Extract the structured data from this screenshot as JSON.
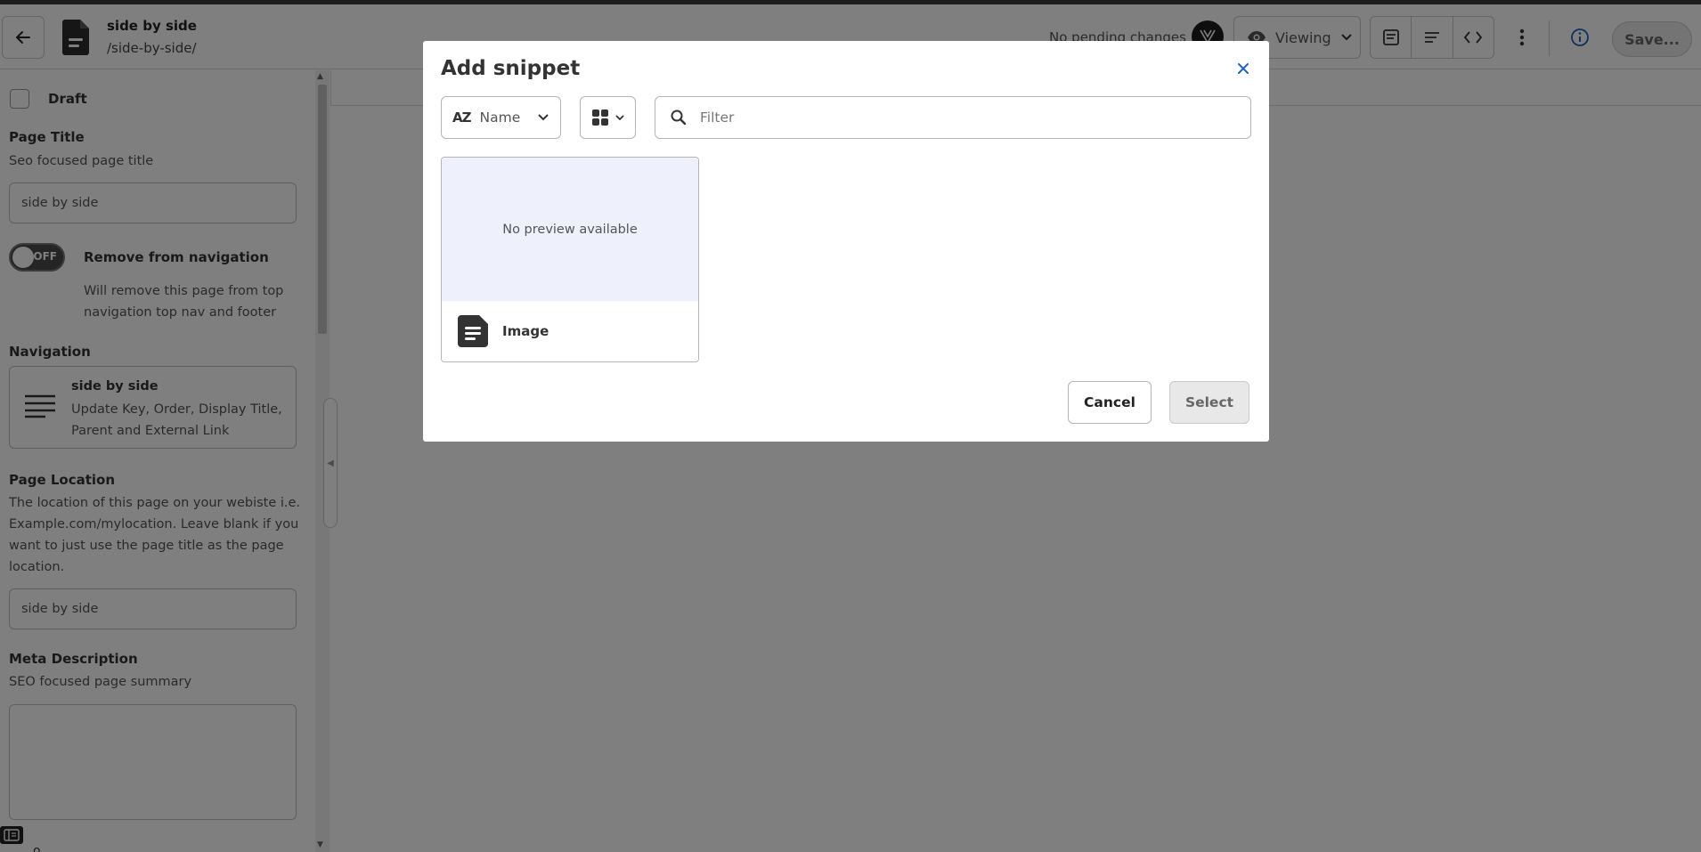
{
  "topbar": {
    "page_name": "side by side",
    "page_path": "/side-by-side/",
    "pending_status": "No pending changes",
    "view_mode": "Viewing",
    "save_label": "Save...",
    "icons": [
      "back-arrow-icon",
      "document-icon",
      "avatar-logo-icon",
      "eye-icon",
      "chevron-down-icon",
      "layout-panel-icon",
      "text-lines-icon",
      "code-icon",
      "more-vertical-icon",
      "info-icon"
    ],
    "accent_color": "#1f5fbf"
  },
  "sidebar": {
    "draft_label": "Draft",
    "page_title": {
      "label": "Page Title",
      "description": "Seo focused page title",
      "value": "side by side"
    },
    "remove_from_navigation": {
      "toggle_state": "OFF",
      "label": "Remove from navigation",
      "description": "Will remove this page from top navigation top nav and footer"
    },
    "navigation": {
      "label": "Navigation",
      "card_title": "side by side",
      "card_description": "Update Key, Order, Display Title, Parent and External Link"
    },
    "page_location": {
      "label": "Page Location",
      "description": "The location of this page on your webiste i.e. Example.com/mylocation. Leave blank if you want to just use the page title as the page location.",
      "value": "side by side"
    },
    "meta_description": {
      "label": "Meta Description",
      "description": "SEO focused page summary",
      "value": ""
    },
    "bottom_partial_text": "o"
  },
  "modal": {
    "title": "Add snippet",
    "sort": {
      "icon": "sort-az-icon",
      "az_glyph": "AZ",
      "selected": "Name"
    },
    "view": {
      "icon": "grid-view-icon"
    },
    "filter": {
      "placeholder": "Filter",
      "value": ""
    },
    "snippets": [
      {
        "preview_text": "No preview available",
        "label": "Image",
        "icon": "document-icon"
      }
    ],
    "cancel_label": "Cancel",
    "select_label": "Select"
  }
}
